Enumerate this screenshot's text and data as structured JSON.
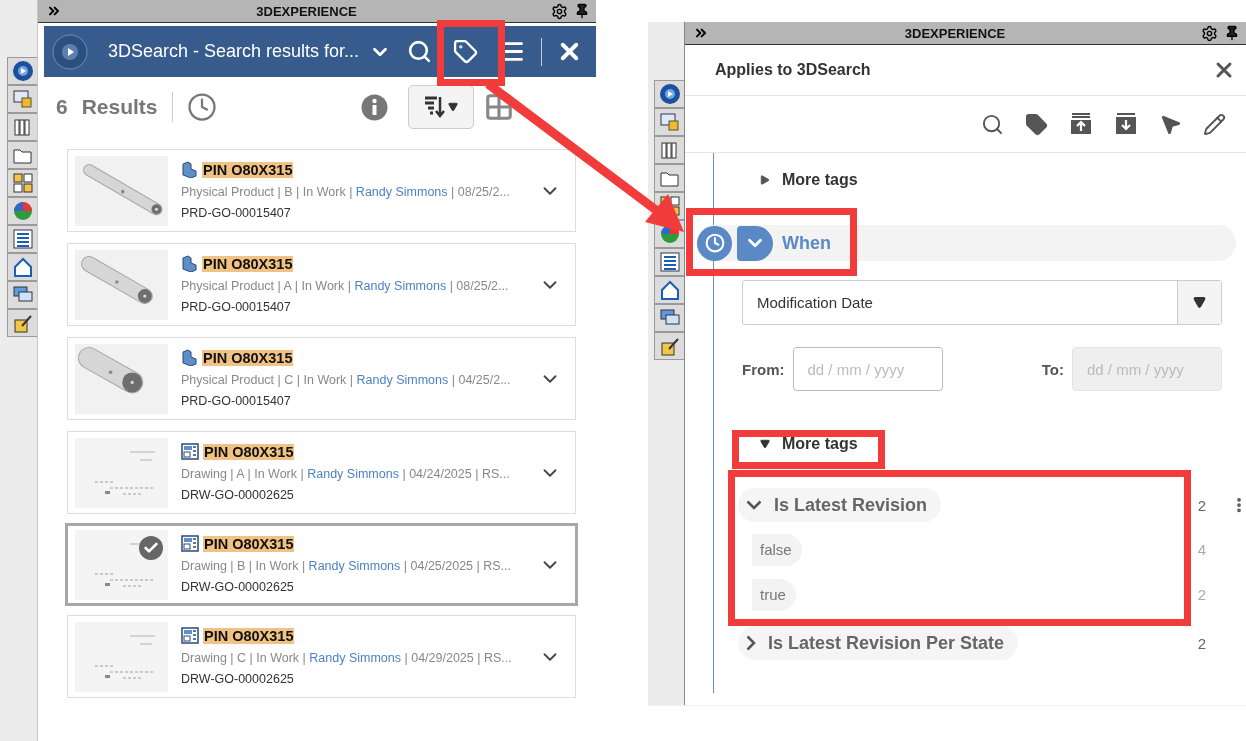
{
  "left_panel": {
    "window_title": "3DEXPERIENCE",
    "header": {
      "title": "3DSearch - Search results for..."
    },
    "results": {
      "count": "6",
      "label": "Results"
    },
    "items": [
      {
        "kind": "product",
        "title": "PIN O80X315",
        "meta": "Physical Product | B | In Work | ",
        "owner": "Randy Simmons",
        "meta_end": " | 08/25/2...",
        "id": "PRD-GO-00015407",
        "selected": false
      },
      {
        "kind": "product",
        "title": "PIN O80X315",
        "meta": "Physical Product | A | In Work | ",
        "owner": "Randy Simmons",
        "meta_end": " | 08/25/2...",
        "id": "PRD-GO-00015407",
        "selected": false
      },
      {
        "kind": "product",
        "title": "PIN O80X315",
        "meta": "Physical Product | C | In Work | ",
        "owner": "Randy Simmons",
        "meta_end": " | 04/25/2...",
        "id": "PRD-GO-00015407",
        "selected": false
      },
      {
        "kind": "drawing",
        "title": "PIN O80X315",
        "meta": "Drawing | A | In Work | ",
        "owner": "Randy Simmons",
        "meta_end": " | 04/24/2025 | RS...",
        "id": "DRW-GO-00002625",
        "selected": false
      },
      {
        "kind": "drawing",
        "title": "PIN O80X315",
        "meta": "Drawing | B | In Work | ",
        "owner": "Randy Simmons",
        "meta_end": " | 04/25/2025 | RS...",
        "id": "DRW-GO-00002625",
        "selected": true
      },
      {
        "kind": "drawing",
        "title": "PIN O80X315",
        "meta": "Drawing | C | In Work | ",
        "owner": "Randy Simmons",
        "meta_end": " | 04/29/2025 | RS...",
        "id": "DRW-GO-00002625",
        "selected": false
      }
    ]
  },
  "right_panel": {
    "window_title": "3DEXPERIENCE",
    "title": "Applies to 3DSearch",
    "more_tags_top": {
      "label": "More tags",
      "expanded": false
    },
    "when": {
      "label": "When"
    },
    "date_type": {
      "value": "Modification Date"
    },
    "from": {
      "label": "From:",
      "placeholder": "dd / mm / yyyy",
      "disabled": false
    },
    "to": {
      "label": "To:",
      "placeholder": "dd / mm / yyyy",
      "disabled": true
    },
    "more_tags": {
      "label": "More tags",
      "expanded": true,
      "groups": [
        {
          "name": "Is Latest Revision",
          "count": "2",
          "expanded": true,
          "values": [
            {
              "label": "false",
              "count": "4"
            },
            {
              "label": "true",
              "count": "2"
            }
          ]
        },
        {
          "name": "Is Latest Revision Per State",
          "count": "2",
          "expanded": false
        }
      ]
    }
  }
}
